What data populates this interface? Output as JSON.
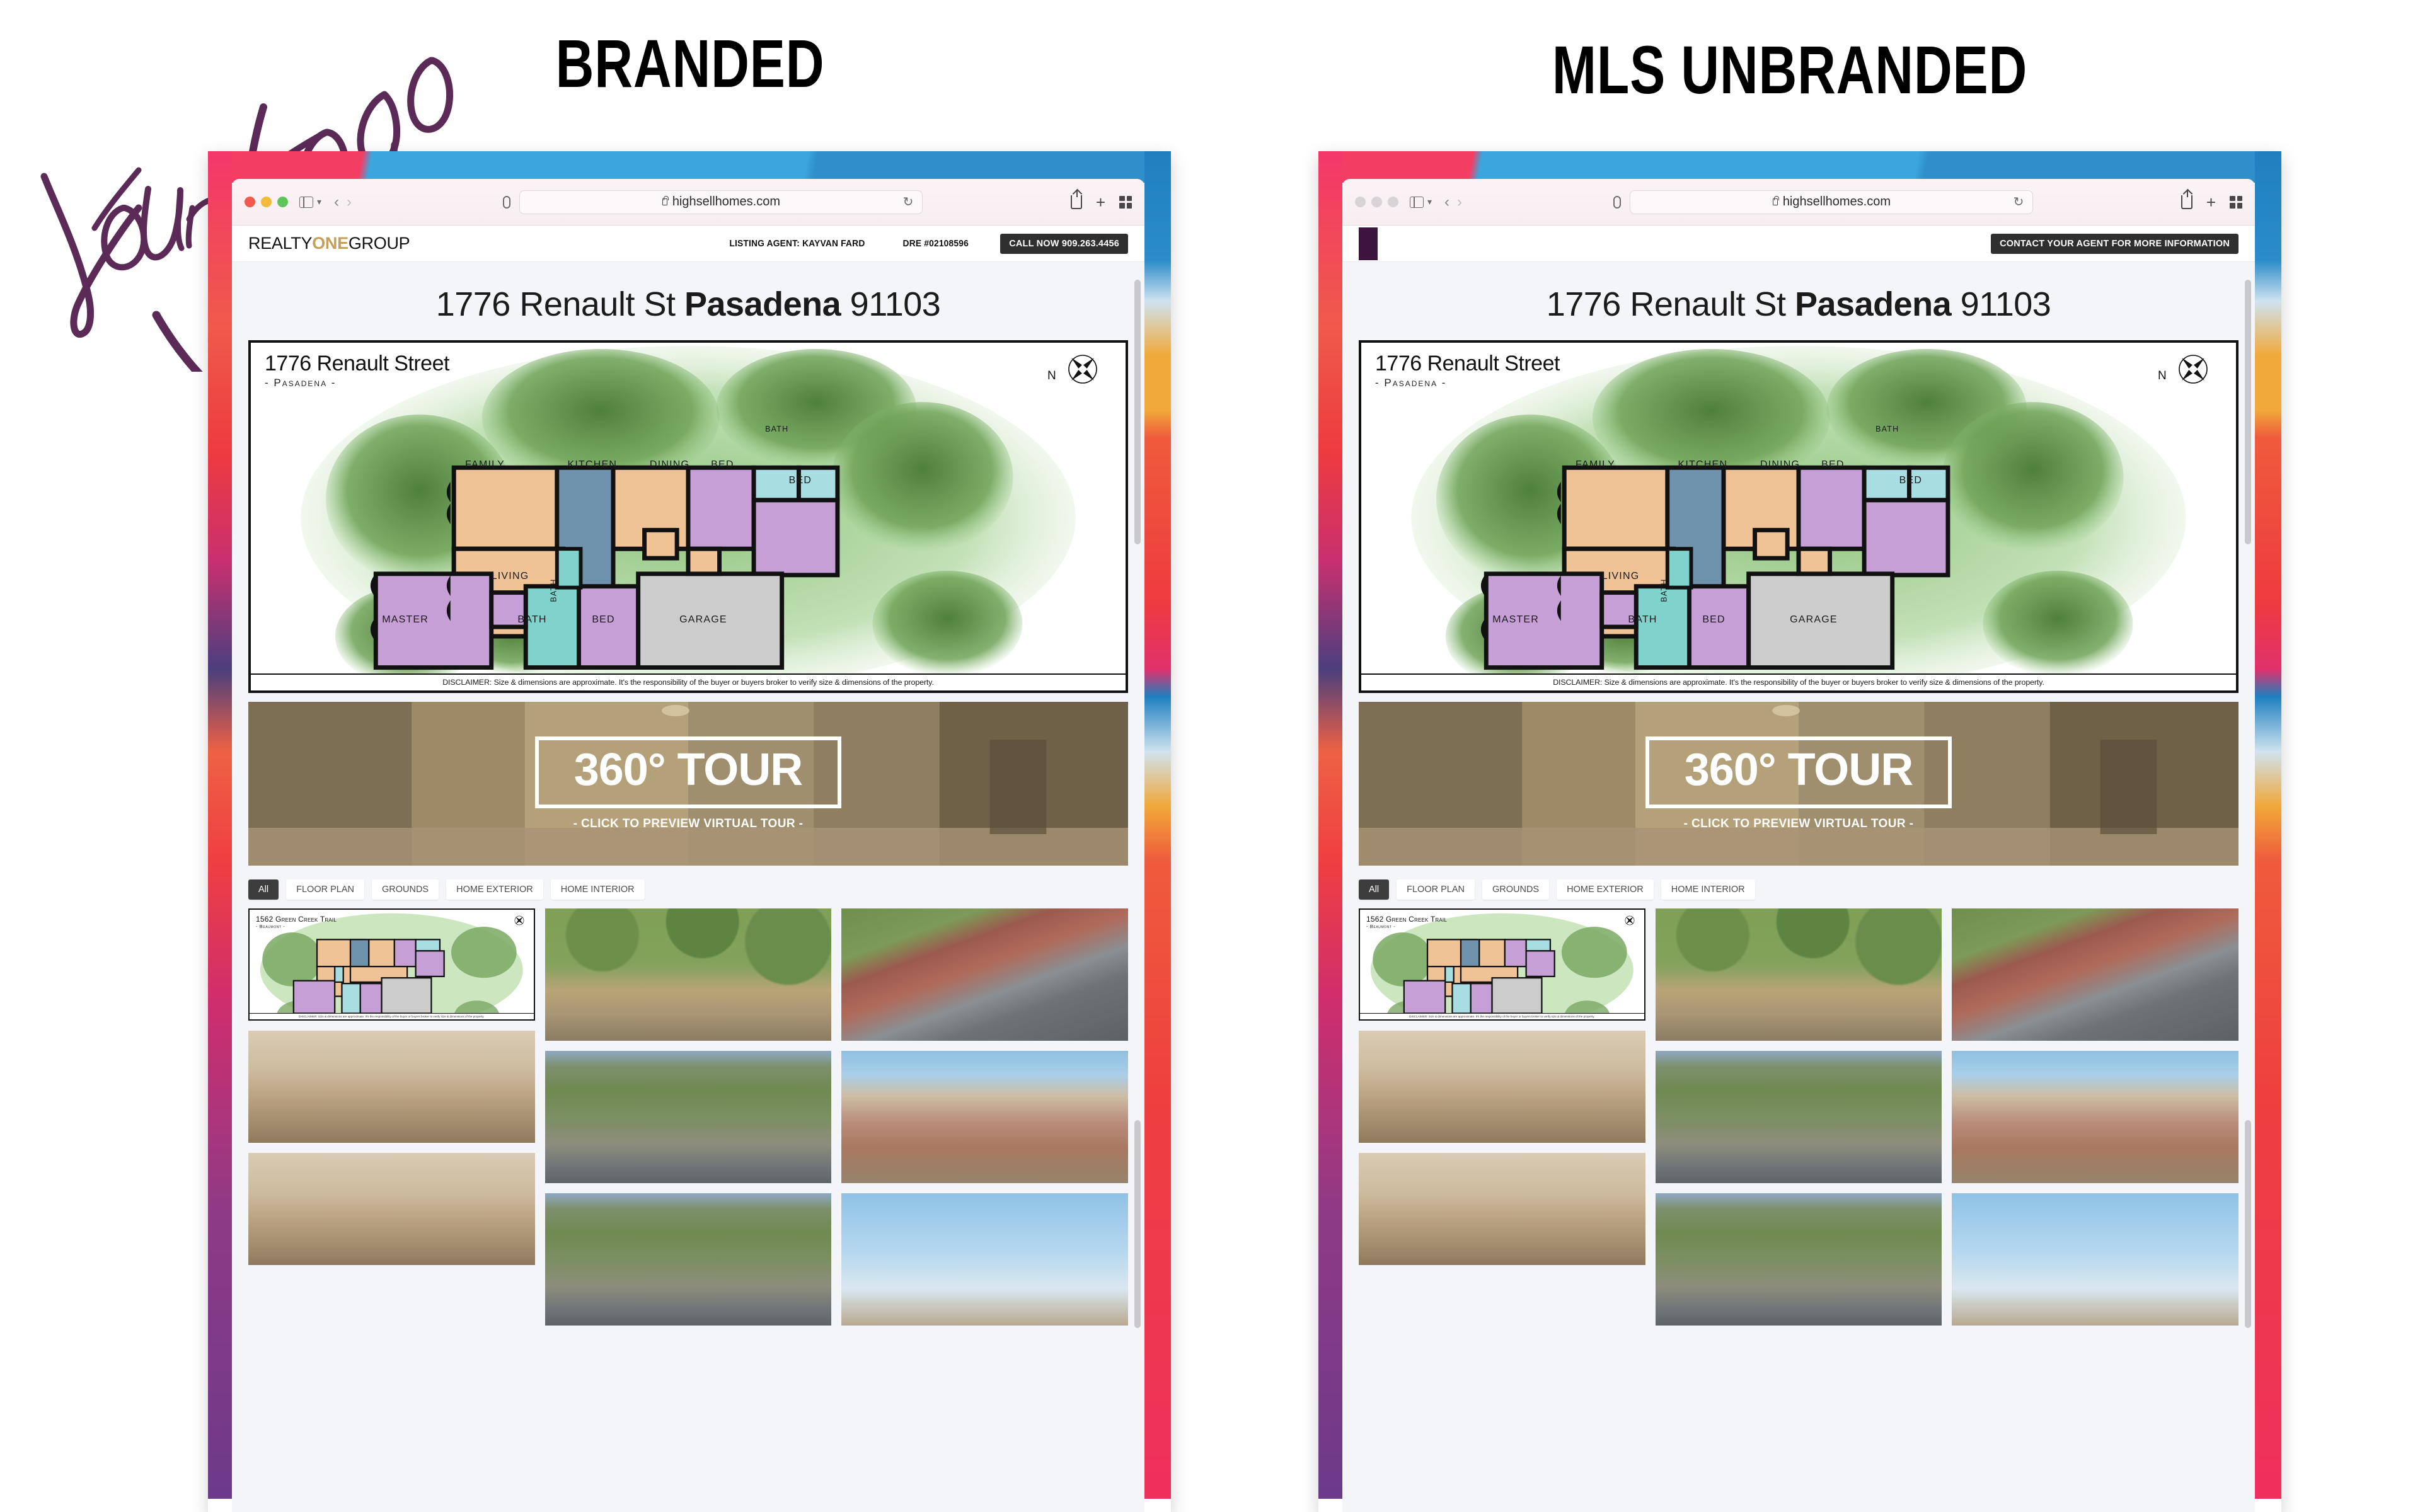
{
  "headings": {
    "branded": "BRANDED",
    "unbranded": "MLS  UNBRANDED"
  },
  "annotation": {
    "handwriting": "Your Logo"
  },
  "browser": {
    "url": "highsellhomes.com",
    "icons": {
      "traffic_red": "close-window-dot",
      "traffic_yellow": "minimize-window-dot",
      "traffic_green": "zoom-window-dot",
      "sidebar": "sidebar-toggle-icon",
      "back": "‹",
      "forward": "›",
      "shield": "privacy-shield-icon",
      "lock": "lock-icon",
      "reload": "↻",
      "share": "share-icon",
      "new_tab": "+",
      "tabs_overview": "tab-grid-icon"
    }
  },
  "branded_site": {
    "logo": {
      "part1": "REALTY",
      "part2": "ONE",
      "part3": "GROUP",
      "accent": "#c3a15c"
    },
    "listing_agent": "LISTING AGENT: KAYVAN FARD",
    "dre": "DRE #02108596",
    "cta": "CALL NOW 909.263.4456",
    "address": {
      "street": "1776 Renault St",
      "city": "Pasadena",
      "zip": "91103"
    }
  },
  "unbranded_site": {
    "cta": "CONTACT YOUR AGENT FOR MORE INFORMATION",
    "address": {
      "street": "1776 Renault St",
      "city": "Pasadena",
      "zip": "91103"
    }
  },
  "floorplan": {
    "title": "1776 Renault Street",
    "subtitle": "- Pasadena -",
    "compass_label": "N",
    "disclaimer": "DISCLAIMER: Size & dimensions are approximate. It's the responsibility of the buyer or buyers broker to verify size & dimensions of the property.",
    "rooms": [
      {
        "name": "FAMILY"
      },
      {
        "name": "KITCHEN"
      },
      {
        "name": "DINING"
      },
      {
        "name": "BED"
      },
      {
        "name": "BATH"
      },
      {
        "name": "BED"
      },
      {
        "name": "LIVING"
      },
      {
        "name": "BATH"
      },
      {
        "name": "MASTER"
      },
      {
        "name": "BATH"
      },
      {
        "name": "BED"
      },
      {
        "name": "GARAGE"
      }
    ],
    "colors": {
      "living_area": "#f0c397",
      "kitchen": "#6f93ad",
      "bedroom": "#c69fd6",
      "bath": "#a8dde2",
      "garage": "#cccccc",
      "lawn": "#a7cf96"
    }
  },
  "tour": {
    "title": "360° TOUR",
    "subtitle": "- CLICK TO PREVIEW VIRTUAL TOUR -"
  },
  "filters": [
    {
      "label": "All",
      "active": true
    },
    {
      "label": "FLOOR PLAN",
      "active": false
    },
    {
      "label": "GROUNDS",
      "active": false
    },
    {
      "label": "HOME EXTERIOR",
      "active": false
    },
    {
      "label": "HOME INTERIOR",
      "active": false
    }
  ],
  "gallery_thumb_plan": {
    "title": "1562 Green Creek Trail",
    "subtitle": "- Beaumont -",
    "disclaimer": "DISCLAIMER: Size & dimensions are approximate. It's the responsibility of the buyer or buyers broker to verify size & dimensions of the property."
  },
  "gallery": {
    "col1": [
      "floor-plan-thumbnail",
      "interior-hallway-photo",
      "interior-hallway-vaulted-photo"
    ],
    "col2": [
      "grounds-trail-photo",
      "aerial-neighborhood-photo",
      "aerial-neighborhood-wide-photo"
    ],
    "col3": [
      "aerial-roof-photo",
      "backyard-patio-photo",
      "sky-exterior-photo"
    ]
  },
  "colors": {
    "frame_pink": "#f43d63",
    "frame_blue": "#3ba6de",
    "cta_dark": "#2f2f2f",
    "page_bg": "#f4f5f9",
    "handwriting_purple": "#5b2a57"
  }
}
